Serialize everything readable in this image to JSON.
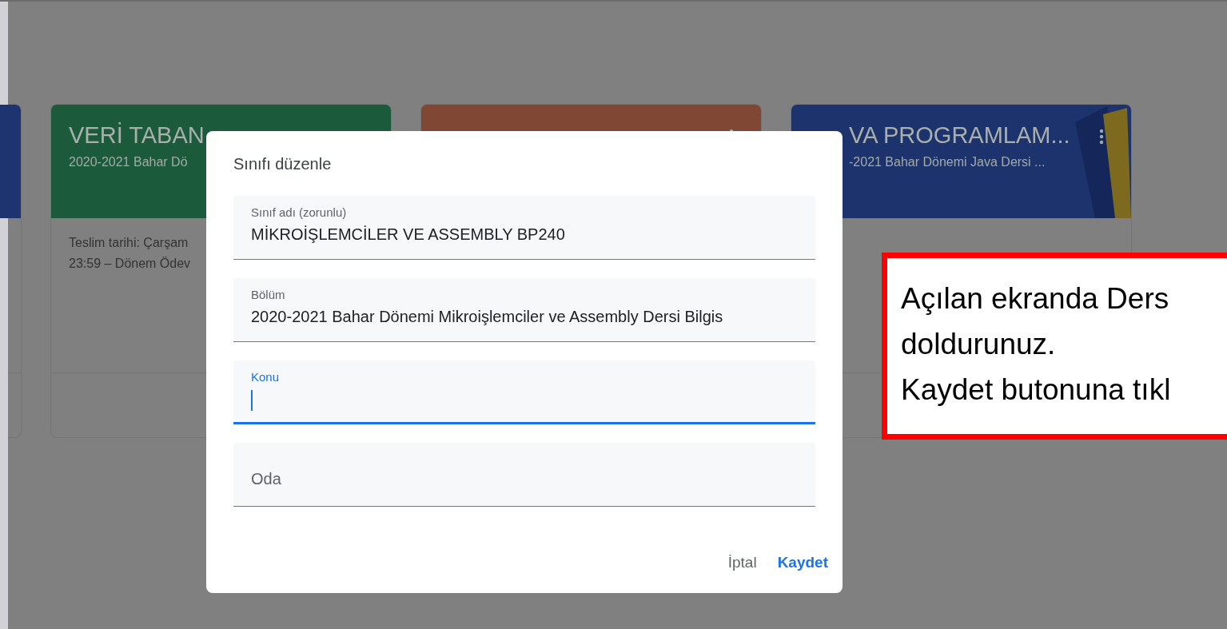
{
  "cards": [
    {
      "color": "#1d3470"
    },
    {
      "color": "#1b5b3b",
      "title": "VERİ TABAN",
      "subtitle": "2020-2021 Bahar Dö",
      "body": [
        "Teslim tarihi: Çarşam",
        "23:59 – Dönem Ödev"
      ]
    },
    {
      "color": "#804734"
    },
    {
      "color": "#1d336e",
      "title": "VA PROGRAMLAM...",
      "subtitle": "-2021 Bahar Dönemi Java Dersi ..."
    }
  ],
  "dialog": {
    "title": "Sınıfı düzenle",
    "fields": [
      {
        "label": "Sınıf adı (zorunlu)",
        "value": "MİKROİŞLEMCİLER VE ASSEMBLY BP240",
        "focused": false
      },
      {
        "label": "Bölüm",
        "value": "2020-2021 Bahar Dönemi Mikroişlemciler ve Assembly Dersi Bilgis",
        "focused": false
      },
      {
        "label": "Konu",
        "focused": true
      },
      {
        "label": "Oda",
        "focused": false
      }
    ],
    "buttons": [
      {
        "label": "İptal",
        "primary": false
      },
      {
        "label": "Kaydet",
        "primary": true
      }
    ]
  },
  "annotation": {
    "text": "Açılan ekranda Ders\ndoldurunuz.\nKaydet butonuna tıkl"
  }
}
